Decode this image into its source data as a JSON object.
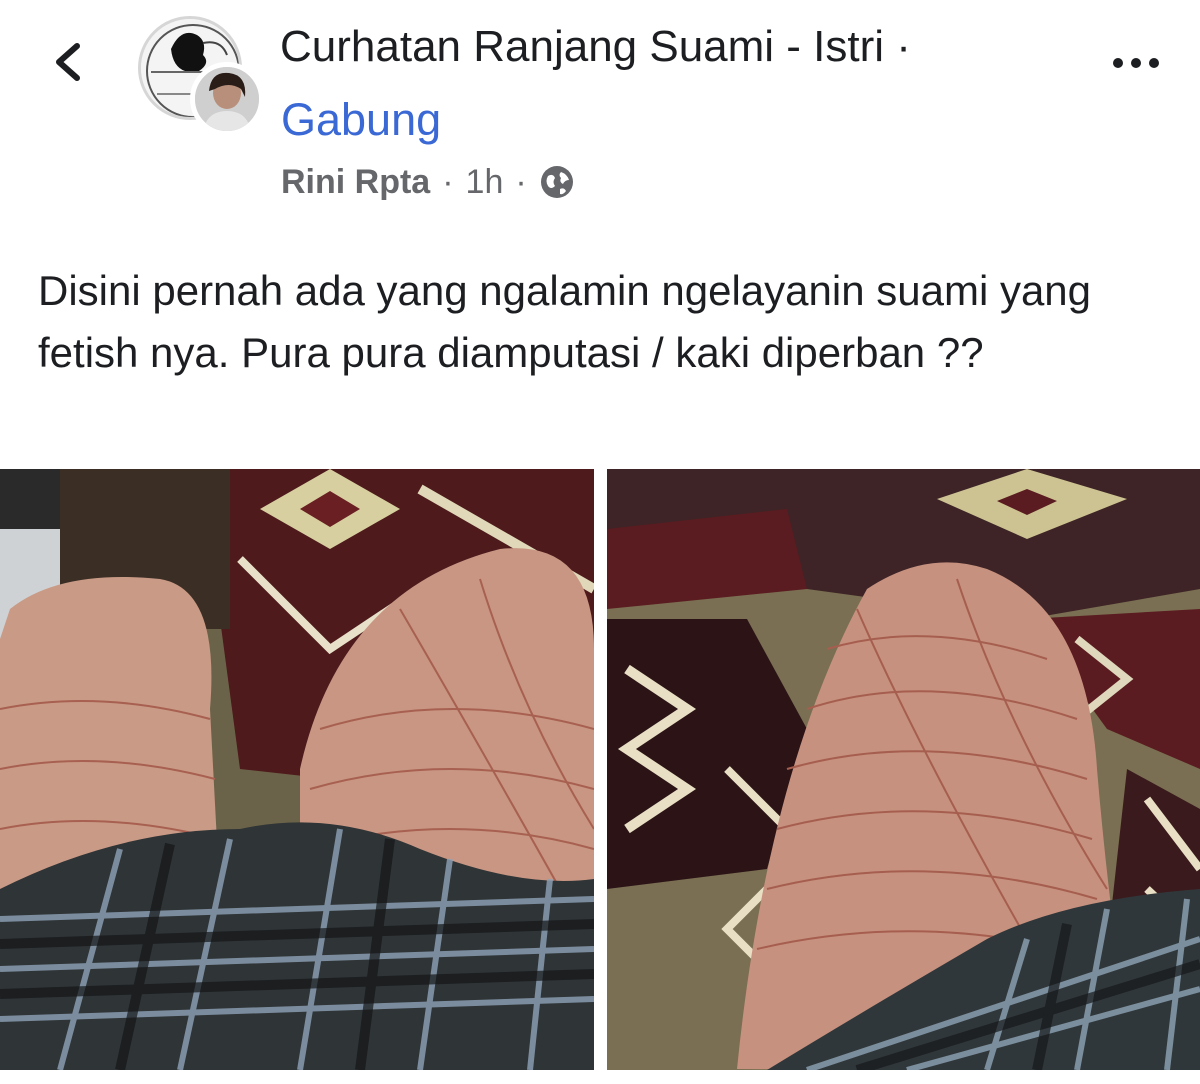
{
  "header": {
    "back_icon": "chevron-left-icon",
    "group_name": "Curhatan Ranjang Suami - Istri ·",
    "join_label": "Gabung",
    "more_icon": "more-horizontal-icon"
  },
  "post": {
    "author": "Rini Rpta",
    "separator": "·",
    "time": "1h",
    "privacy_icon": "globe-icon",
    "text": "Disini pernah ada yang ngalamin ngelayanin suami yang fetish nya. Pura pura diamputasi / kaki diperban ??",
    "photos": [
      {
        "name": "photo-1"
      },
      {
        "name": "photo-2"
      }
    ]
  },
  "colors": {
    "link": "#3a68d4",
    "meta": "#65676b",
    "text": "#1c1e21"
  }
}
